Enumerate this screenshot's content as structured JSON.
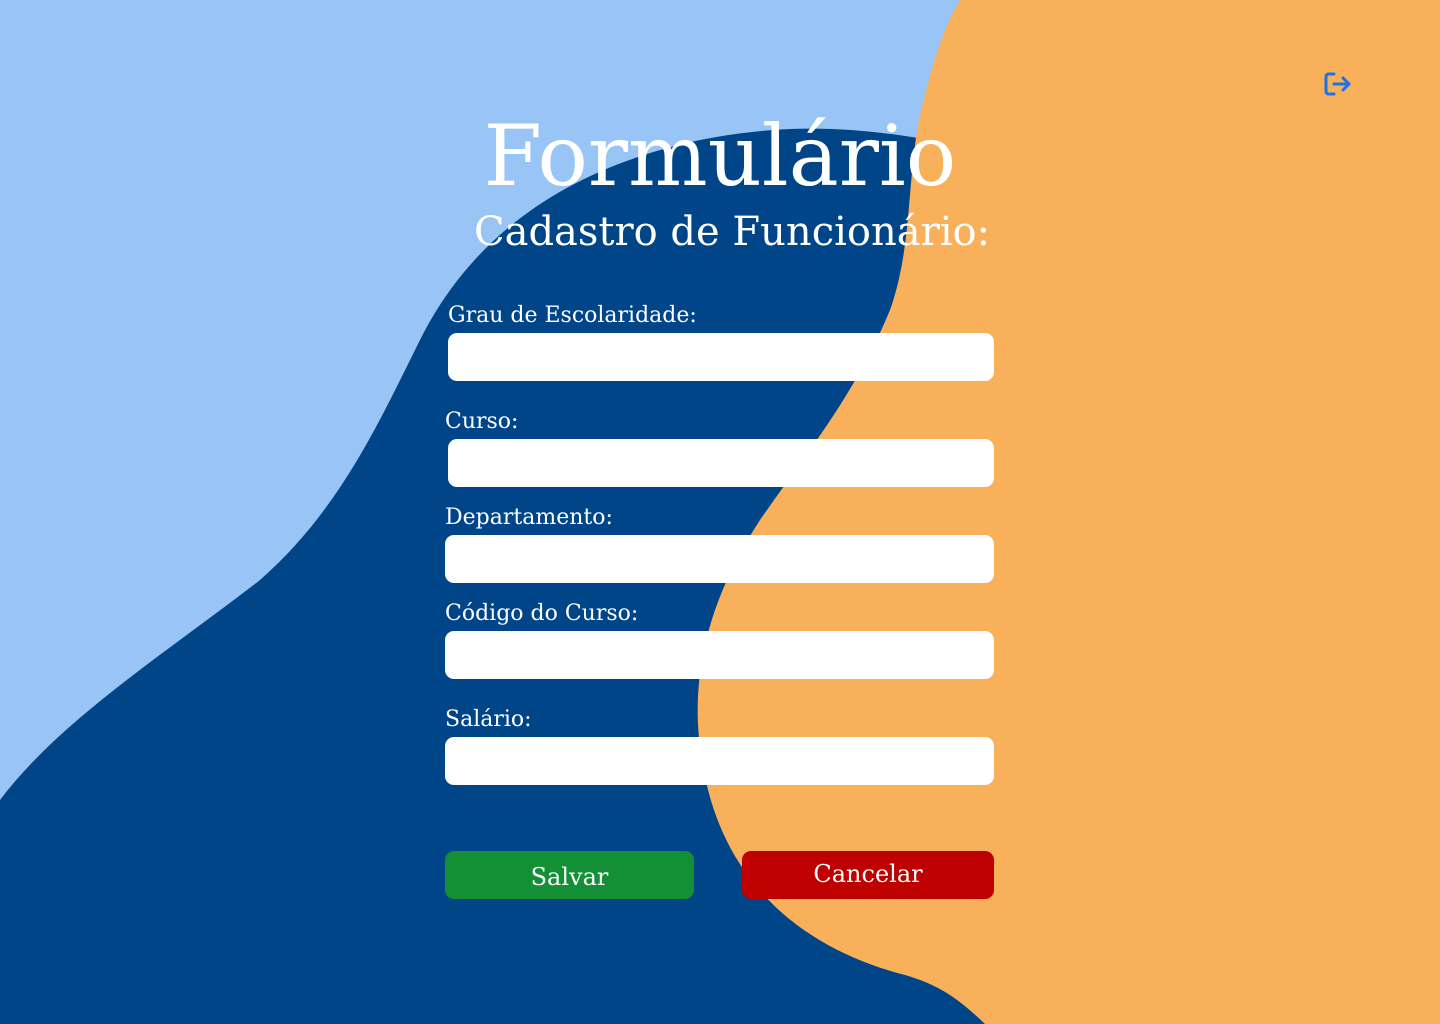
{
  "colors": {
    "light_blue": "#98c5f6",
    "dark_blue": "#004587",
    "orange": "#f9b05a",
    "save_green": "#138f35",
    "cancel_red": "#be0000",
    "icon_blue": "#1a73e8"
  },
  "header": {
    "title": "Formulário",
    "subtitle": "Cadastro de Funcionário:",
    "logout_icon": "logout-icon"
  },
  "form": {
    "fields": [
      {
        "label": "Grau de Escolaridade:",
        "value": "",
        "placeholder": ""
      },
      {
        "label": "Curso:",
        "value": "",
        "placeholder": ""
      },
      {
        "label": "Departamento:",
        "value": "",
        "placeholder": ""
      },
      {
        "label": "Código do Curso:",
        "value": "",
        "placeholder": ""
      },
      {
        "label": "Salário:",
        "value": "",
        "placeholder": ""
      }
    ]
  },
  "actions": {
    "save_label": "Salvar",
    "cancel_label": "Cancelar"
  }
}
